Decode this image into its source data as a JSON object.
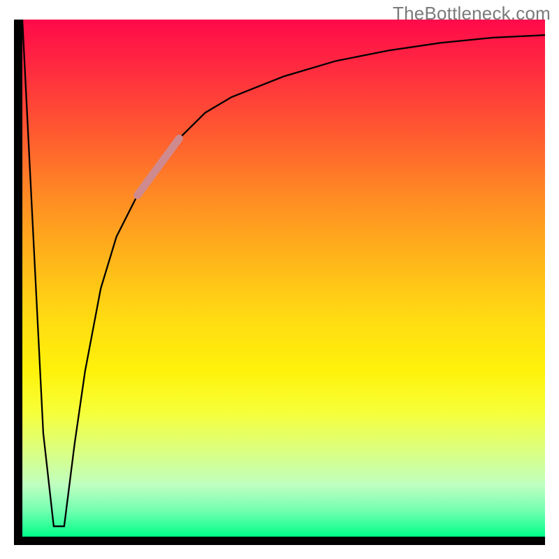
{
  "watermark": "TheBottleneck.com",
  "chart_data": {
    "type": "line",
    "title": "",
    "xlabel": "",
    "ylabel": "",
    "xlim": [
      0,
      100
    ],
    "ylim": [
      0,
      100
    ],
    "grid": false,
    "legend": false,
    "annotations": [],
    "series": [
      {
        "name": "bottleneck-curve",
        "color": "#000000",
        "x": [
          0,
          2,
          4,
          6,
          8,
          10,
          12,
          15,
          18,
          22,
          26,
          30,
          35,
          40,
          50,
          60,
          70,
          80,
          90,
          100
        ],
        "y": [
          100,
          60,
          20,
          2,
          2,
          18,
          32,
          48,
          58,
          66,
          72,
          77,
          82,
          85,
          89,
          92,
          94,
          95.5,
          96.5,
          97
        ]
      },
      {
        "name": "highlight-segment",
        "color": "#cf8a8f",
        "x": [
          22,
          30
        ],
        "y": [
          66,
          77
        ]
      }
    ],
    "background_gradient": {
      "orientation": "vertical",
      "stops": [
        {
          "pos": 0.0,
          "color": "#ff0a4a"
        },
        {
          "pos": 0.5,
          "color": "#ffdc12"
        },
        {
          "pos": 0.8,
          "color": "#f6ff3a"
        },
        {
          "pos": 1.0,
          "color": "#00ff88"
        }
      ]
    }
  }
}
